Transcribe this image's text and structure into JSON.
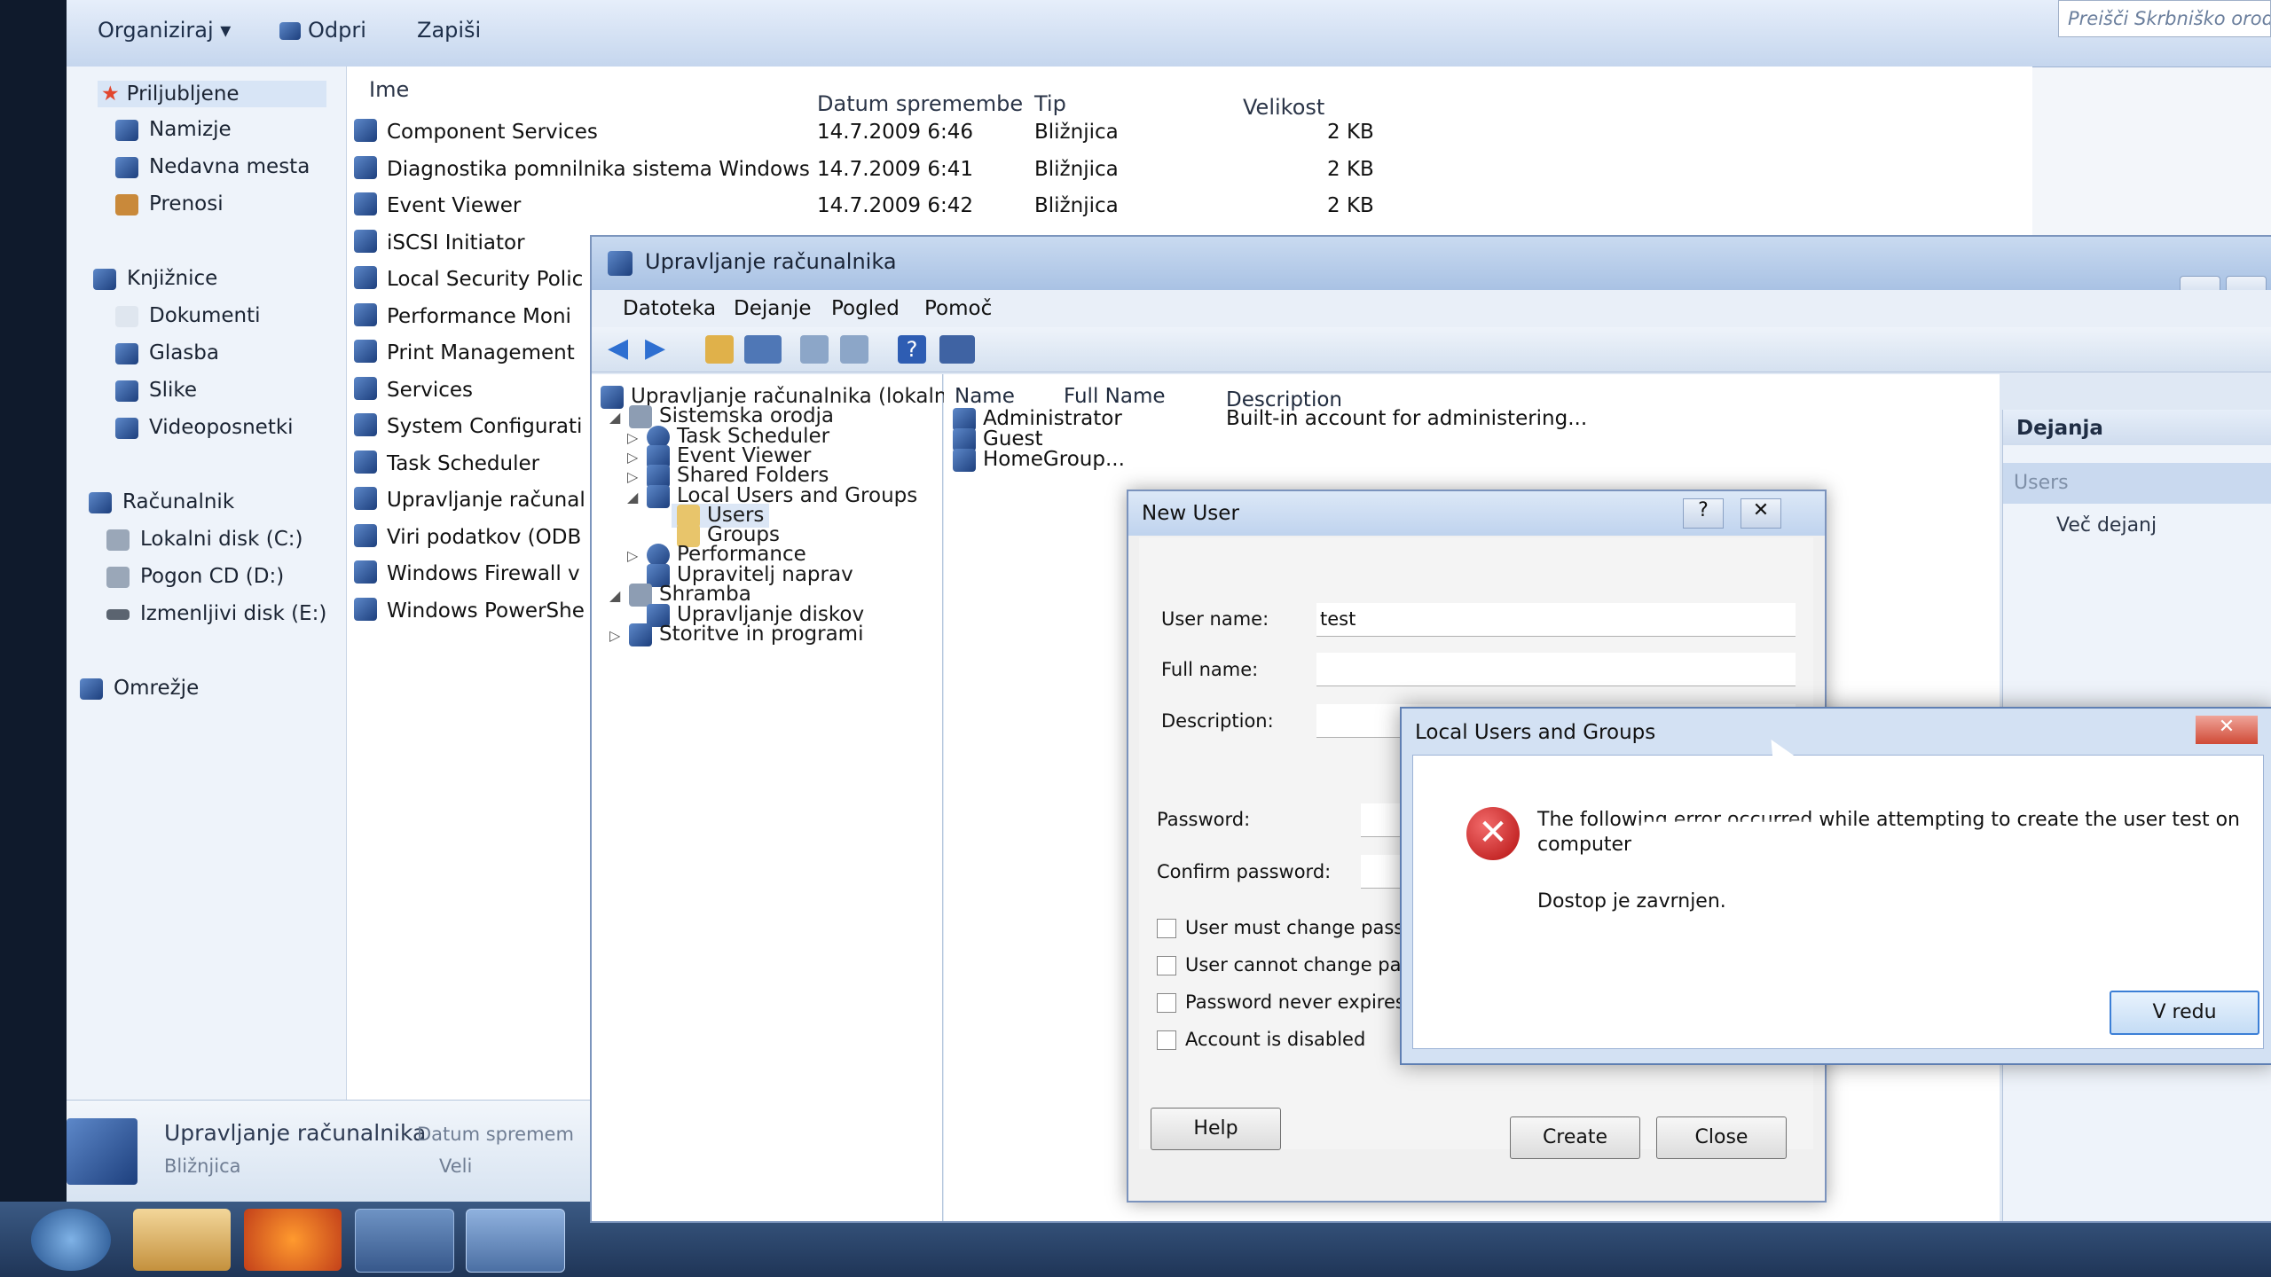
{
  "explorer": {
    "toolbar": {
      "organize": "Organiziraj ▾",
      "open": "Odpri",
      "burn": "Zapiši",
      "search_placeholder": "Preišči Skrbniško orodja"
    },
    "nav": {
      "favorites": "Priljubljene",
      "desktop": "Namizje",
      "recent": "Nedavna mesta",
      "downloads": "Prenosi",
      "libraries": "Knjižnice",
      "documents": "Dokumenti",
      "music": "Glasba",
      "pictures": "Slike",
      "videos": "Videoposnetki",
      "computer": "Računalnik",
      "disk_c": "Lokalni disk (C:)",
      "disk_d": "Pogon CD (D:)",
      "disk_e": "Izmenljivi disk (E:)",
      "network": "Omrežje"
    },
    "columns": {
      "name": "Ime",
      "date": "Datum spremembe",
      "type": "Tip",
      "size": "Velikost"
    },
    "files": [
      {
        "name": "Component Services",
        "date": "14.7.2009 6:46",
        "type": "Bližnjica",
        "size": "2 KB"
      },
      {
        "name": "Diagnostika pomnilnika sistema Windows",
        "date": "14.7.2009 6:41",
        "type": "Bližnjica",
        "size": "2 KB"
      },
      {
        "name": "Event Viewer",
        "date": "14.7.2009 6:42",
        "type": "Bližnjica",
        "size": "2 KB"
      },
      {
        "name": "iSCSI Initiator"
      },
      {
        "name": "Local Security Polic"
      },
      {
        "name": "Performance Moni"
      },
      {
        "name": "Print Management"
      },
      {
        "name": "Services"
      },
      {
        "name": "System Configurati"
      },
      {
        "name": "Task Scheduler"
      },
      {
        "name": "Upravljanje računal"
      },
      {
        "name": "Viri podatkov (ODB"
      },
      {
        "name": "Windows Firewall v"
      },
      {
        "name": "Windows PowerShe"
      }
    ],
    "details": {
      "name": "Upravljanje računalnika",
      "date_label": "Datum spremem",
      "type": "Bližnjica",
      "size_label": "Veli"
    }
  },
  "cm": {
    "title": "Upravljanje računalnika",
    "menu": [
      "Datoteka",
      "Dejanje",
      "Pogled",
      "Pomoč"
    ],
    "tree": {
      "root": "Upravljanje računalnika (lokaln",
      "system_tools": "Sistemska orodja",
      "task_scheduler": "Task Scheduler",
      "event_viewer": "Event Viewer",
      "shared_folders": "Shared Folders",
      "local_users": "Local Users and Groups",
      "users": "Users",
      "groups": "Groups",
      "performance": "Performance",
      "device_manager": "Upravitelj naprav",
      "storage": "Shramba",
      "disk_mgmt": "Upravljanje diskov",
      "services": "Storitve in programi"
    },
    "list": {
      "columns": {
        "name": "Name",
        "full_name": "Full Name",
        "description": "Description"
      },
      "rows": [
        {
          "name": "Administrator",
          "description": "Built-in account for administering..."
        },
        {
          "name": "Guest"
        },
        {
          "name": "HomeGroup..."
        }
      ]
    },
    "actions": {
      "header": "Dejanja",
      "users": "Users",
      "more": "Več dejanj"
    }
  },
  "new_user": {
    "title": "New User",
    "help_glyph": "?",
    "close_glyph": "✕",
    "labels": {
      "username": "User name:",
      "fullname": "Full name:",
      "description": "Description:",
      "password": "Password:",
      "confirm": "Confirm password:"
    },
    "values": {
      "username": "test",
      "fullname": "",
      "description": ""
    },
    "checkboxes": [
      "User must change passwo",
      "User cannot change pass",
      "Password never expires",
      "Account is disabled"
    ],
    "buttons": {
      "help": "Help",
      "create": "Create",
      "close": "Close"
    }
  },
  "error": {
    "title": "Local Users and Groups",
    "close_glyph": "✕",
    "icon_glyph": "✕",
    "message_line1": "The following error occurred while attempting to create the user test on",
    "message_line2": "computer",
    "detail": "Dostop je zavrnjen.",
    "ok": "V redu"
  }
}
